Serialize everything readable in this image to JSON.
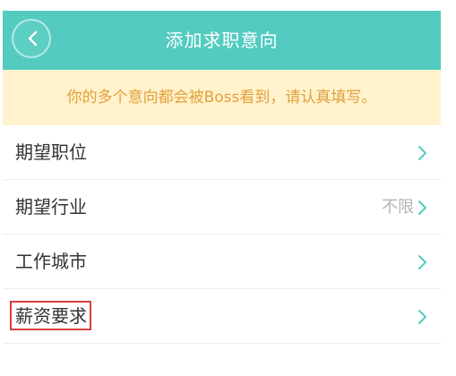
{
  "header": {
    "title": "添加求职意向",
    "back_icon": "chevron-left-icon",
    "background_color": "#53cbc0"
  },
  "notice": {
    "text": "你的多个意向都会被Boss看到，请认真填写。",
    "background_color": "#fff2cc",
    "text_color": "#e3a03c"
  },
  "list": {
    "rows": [
      {
        "label": "期望职位",
        "value": "",
        "icon": "chevron-right-icon"
      },
      {
        "label": "期望行业",
        "value": "不限",
        "icon": "chevron-right-icon"
      },
      {
        "label": "工作城市",
        "value": "",
        "icon": "chevron-right-icon"
      },
      {
        "label": "薪资要求",
        "value": "",
        "icon": "chevron-right-icon",
        "highlighted": true
      }
    ]
  },
  "colors": {
    "accent": "#53cbc0",
    "highlight_border": "#d94040"
  }
}
